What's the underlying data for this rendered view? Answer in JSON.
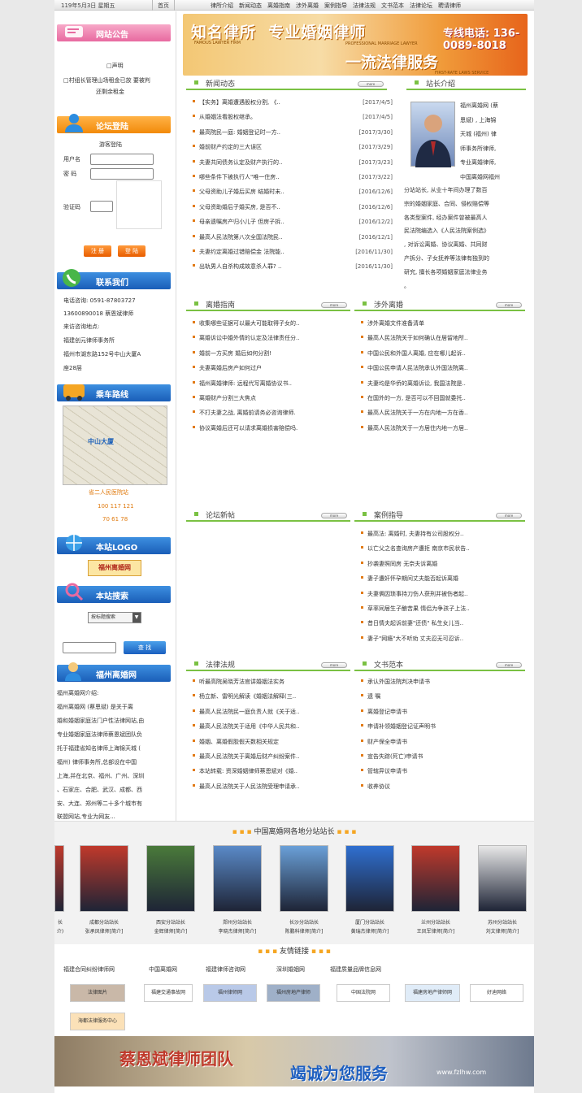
{
  "topbar": {
    "date": "119年5月3日 星期五",
    "home": "首页",
    "nav": [
      "律所介绍",
      "新闻动态",
      "离婚指南",
      "涉外离婚",
      "案例指导",
      "法律法规",
      "文书范本",
      "法律论坛",
      "聘请律师"
    ]
  },
  "sidebar": {
    "notice_title": "网站公告",
    "notice_lines": [
      "□声明",
      "□村组长管理山场租金已放 要被判",
      "还剩余租金"
    ],
    "login_title": "论坛登陆",
    "login_sub": "游客登陆",
    "username_label": "用户名",
    "password_label": "密 码",
    "captcha_label": "验证码",
    "register_btn": "注 册",
    "login_btn": "登 陆",
    "contact_title": "联系我们",
    "contact_lines": [
      "电话咨询: 0591-87803727",
      "13600890018 蔡恩斌律师",
      "来访咨询地点:",
      "福建创元律师事务所",
      "福州市湖东路152号中山大厦A",
      "座28层"
    ],
    "route_title": "乘车路线",
    "map_label": "中山大厦",
    "route_lines": [
      "省二人民医院站",
      "100 117 121",
      "70 61 78"
    ],
    "logo_title": "本站LOGO",
    "logo_text": "福州离婚网",
    "search_title": "本站搜索",
    "search_select": "按标题搜索",
    "search_btn": "查 找",
    "about_title": "福州离婚网",
    "about_lines": [
      "福州离婚网介绍:",
      "  福州离婚网 (蔡恩斌) 是关于离",
      "婚和婚姻家庭法门户性法律网站,由",
      "专业婚姻家庭法律师蔡恩斌团队负",
      "托于福建省知名律师上海锦天城 (",
      "福州) 律师事务所,总部设在中国",
      "上海,并在北京、福州、广州、深圳",
      "、石家庄、合肥、武汉、成都、西",
      "安、大连、郑州等二十多个城市有",
      "联盟网站,专业为网友..."
    ]
  },
  "banner": {
    "title1": "知名律所",
    "title2": "专业婚姻律师",
    "phone": "专线电话: 136-0089-8018",
    "slogan": "一流法律服务",
    "sub1": "FAMOUS LAWYER FIRM",
    "sub2": "PROFESSIONAL MARRIAGE LAWYER",
    "sub3": "FIRST-RATE LAWS SERVICE"
  },
  "more": "more",
  "news": {
    "title": "新闻动态",
    "items": [
      {
        "t": "【实务】离婚遭遇股权分割, 《..",
        "d": "[2017/4/5]"
      },
      {
        "t": "从婚姻法看股权继承。",
        "d": "[2017/4/5]"
      },
      {
        "t": "最高院民一庭: 婚姻登记时一方..",
        "d": "[2017/3/30]"
      },
      {
        "t": "婚前财产约定的三大误区",
        "d": "[2017/3/29]"
      },
      {
        "t": "夫妻共同债务认定及财产执行的..",
        "d": "[2017/3/23]"
      },
      {
        "t": "哪些条件下被执行人\"唯一住房..",
        "d": "[2017/3/22]"
      },
      {
        "t": "父母资助儿子婚后买房 结婚时未..",
        "d": "[2016/12/6]"
      },
      {
        "t": "父母资助婚后子婚买房, 是否不..",
        "d": "[2016/12/6]"
      },
      {
        "t": "母亲遗嘱房产归小儿子 但房子拆..",
        "d": "[2016/12/2]"
      },
      {
        "t": "最高人民法院第八次全国法院民..",
        "d": "[2016/12/1]"
      },
      {
        "t": "夫妻约定离婚过错赔偿金 法院能..",
        "d": "[2016/11/30]"
      },
      {
        "t": "出轨男人自杀构成故意杀人罪? ..",
        "d": "[2016/11/30]"
      }
    ]
  },
  "intro": {
    "title": "站长介绍",
    "lines": [
      "福州离婚网 (蔡",
      "恩斌) , 上海锦",
      "天城 (福州) 律",
      "师事务所律师,",
      "专业离婚律师,",
      "中国离婚网福州",
      "分站站长, 从业十年间办理了数百",
      "宗的婚姻家庭、合同、侵权赔偿等",
      "各类型案件, 经办案件曾被最高人",
      "民法院编选入《人民法院案例选》",
      ", 对诉讼离婚、协议离婚、共同财",
      "产拆分、子女抚养等法律有独到的",
      "研究, 擅长各项婚姻家庭法律业务",
      "。"
    ]
  },
  "guide": {
    "title": "离婚指南",
    "items": [
      "收集哪些证据可以最大可能取得子女的..",
      "离婚诉讼中婚外情的认定及法律责任分..",
      "婚前一方买房 婚后如何分割!",
      "夫妻离婚后房产如何过户",
      "福州离婚律师: 远程代写离婚协议书..",
      "离婚财产分割三大焦点",
      "不打夫妻之战, 离婚前请务必咨询律师.",
      "协议离婚后还可以请求离婚损害赔偿吗."
    ]
  },
  "foreign": {
    "title": "涉外离婚",
    "items": [
      "涉外离婚文件准备清单",
      "最高人民法院关于如何确认在居留地所..",
      "中国公民和外国人离婚, 应在哪儿起诉..",
      "中国公民申请人民法院承认外国法院离..",
      "夫妻均是华侨的离婚诉讼, 我国法院是..",
      "在国外的一方, 是否可以不回国就委托..",
      "最高人民法院关于一方在内地一方在香..",
      "最高人民法院关于一方居住内地一方居.."
    ]
  },
  "forum": {
    "title": "论坛新帖",
    "items": []
  },
  "cases": {
    "title": "案例指导",
    "items": [
      "最高法: 离婚时, 夫妻持有公司股权分..",
      "以亡父之名查询房产遭拒 南京市民状告..",
      "抄袭妻照同房 无奈夫诉离婚",
      "妻子遭奸怀孕期间丈夫能否起诉离婚",
      "夫妻俩因琐事持刀伤人获刑并被伤者起..",
      "草率同居生子酿苦果 情侣为争孩子上法..",
      "昔日情夫起诉前妻\"还债\" 私生女儿当..",
      "妻子\"网瘾\"大不听劝 丈夫忍无可忍诉.."
    ]
  },
  "laws": {
    "title": "法律法规",
    "items": [
      "听最高院吴晓芳法官讲婚姻法实务",
      "杨立新、雷明光解读《婚姻法解释(三..",
      "最高人民法院民一庭负责人就《关于适..",
      "最高人民法院关于适用《中华人民共和..",
      "婚姻、离婚假胶假天数相关规定",
      "最高人民法院关于离婚后财产纠纷案件..",
      "本站转载: 资深婚姻律师蔡恩斌对《婚..",
      "最高人民法院关于人民法院受理申请承.."
    ]
  },
  "docs": {
    "title": "文书范本",
    "items": [
      "承认外国法院判决申请书",
      "遗      嘱",
      "离婚登记申请书",
      "申请补领婚姻登记证声明书",
      "财产保全申请书",
      "宣告失踪(死亡)申请书",
      "管辖异议申请书",
      "收养协议"
    ]
  },
  "branches": {
    "title": "中国离婚网各地分站站长",
    "people": [
      {
        "n1": "长",
        "n2": "介)"
      },
      {
        "n1": "成都分站站长",
        "n2": "张承凤律师[简介]"
      },
      {
        "n1": "西安分站站长",
        "n2": "金辉律师[简介]"
      },
      {
        "n1": "郑州分站站长",
        "n2": "李晓杰律师[简介]"
      },
      {
        "n1": "长沙分站站长",
        "n2": "陈鹏科律师[简介]"
      },
      {
        "n1": "厦门分站站长",
        "n2": "黄瑞杰律师[简介]"
      },
      {
        "n1": "兰州分站站长",
        "n2": "王凤军律师[简介]"
      },
      {
        "n1": "苏州分站站长",
        "n2": "刘文律师[简介]"
      }
    ]
  },
  "friends": {
    "title": "友情链接",
    "text_links": [
      "福建合同纠纷律师网",
      "中国离婚网",
      "福建律师咨询网",
      "深圳婚姻网",
      "福建质量品牌信息网"
    ],
    "logo_links": [
      "法律图片",
      "福建交通事故网",
      "福州律师网",
      "福州房地产律师",
      "中国法院网",
      "福建房地产律师网",
      "好迪网络",
      "海都法律服务中心"
    ]
  },
  "footer_banner": {
    "t1": "蔡恩斌律师团队",
    "t2": "竭诚为您服务",
    "url": "www.fzlhw.com"
  }
}
